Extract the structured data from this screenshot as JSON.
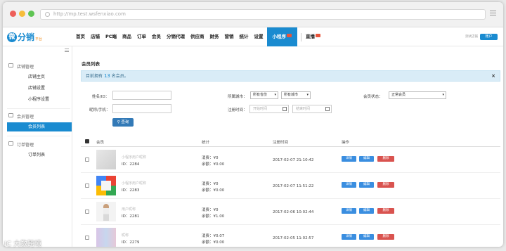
{
  "browser": {
    "url": "http://mp.test.wsfenxiao.com"
  },
  "logo": {
    "mark": "微",
    "text": "分销",
    "sub": "平台"
  },
  "nav": {
    "items": [
      {
        "label": "首页",
        "active": false
      },
      {
        "label": "店铺",
        "active": false
      },
      {
        "label": "PC端",
        "active": false
      },
      {
        "label": "商品",
        "active": false
      },
      {
        "label": "订单",
        "active": false
      },
      {
        "label": "会员",
        "active": false
      },
      {
        "label": "分销代理",
        "active": false
      },
      {
        "label": "供应商",
        "active": false
      },
      {
        "label": "财务",
        "active": false
      },
      {
        "label": "营销",
        "active": false
      },
      {
        "label": "统计",
        "active": false
      },
      {
        "label": "设置",
        "active": false
      },
      {
        "label": "小程序",
        "active": true
      },
      {
        "label": "直播",
        "active": false
      }
    ],
    "account_text": "测试店铺",
    "account_button": "账户"
  },
  "sidebar": {
    "group1": {
      "title": "店铺管理",
      "items": [
        "店铺主页",
        "店铺设置",
        "小程序设置"
      ]
    },
    "group2": {
      "title": "会员管理",
      "items": [
        "会员列表"
      ]
    },
    "group3": {
      "title": "订单管理",
      "items": [
        "订单列表"
      ]
    }
  },
  "main": {
    "title": "会员列表",
    "notice_prefix": "目前拥有",
    "notice_count": "13",
    "notice_suffix": "名会员。",
    "filters": {
      "name_label": "姓名/ID：",
      "phone_label": "昵称/手机：",
      "city_label": "所属城市：",
      "province_select": "所有省份",
      "city_select": "所有城市",
      "status_label": "会员状态：",
      "status_select": "正常会员",
      "time_label": "注册时间：",
      "start_placeholder": "开始时间",
      "end_placeholder": "结束时间",
      "query_button": "查询"
    },
    "table": {
      "headers": [
        "会员",
        "统计",
        "注册时间",
        "操作"
      ],
      "rows": [
        {
          "name": "小程序用户昵称",
          "id": "ID：2284",
          "consume": "消费：¥0",
          "balance": "余额：¥0.00",
          "time": "2017-02-07 21:10:42"
        },
        {
          "name": "小程序用户昵称",
          "id": "ID：2283",
          "consume": "消费：¥0",
          "balance": "余额：¥0.00",
          "time": "2017-02-07 11:51:22"
        },
        {
          "name": "用户昵称",
          "id": "ID：2281",
          "consume": "消费：¥0",
          "balance": "余额：¥1.00",
          "time": "2017-02-06 10:02:44"
        },
        {
          "name": "昵称",
          "id": "ID：2279",
          "consume": "消费：¥0.07",
          "balance": "余额：¥0.00",
          "time": "2017-02-05 11:02:57"
        }
      ],
      "actions": {
        "detail": "详情",
        "edit": "编辑",
        "delete": "删除"
      }
    }
  },
  "watermark": "大数跨境"
}
